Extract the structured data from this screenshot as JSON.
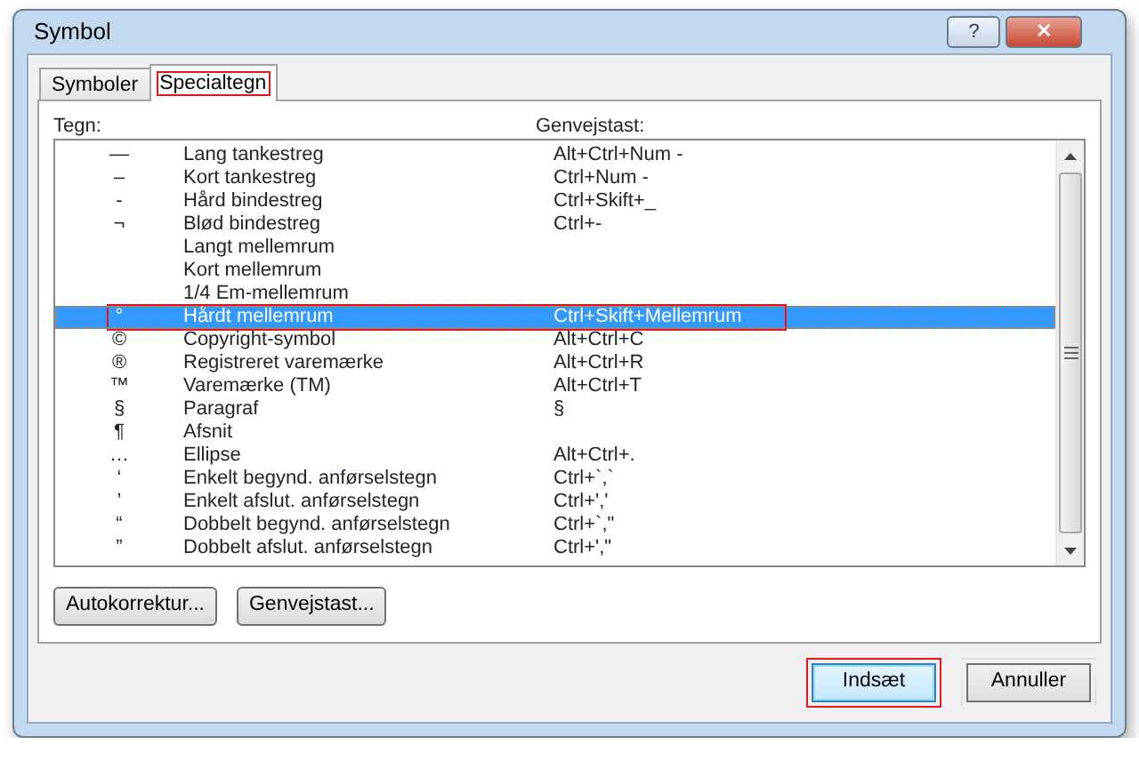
{
  "window": {
    "title": "Symbol",
    "help_button": "?",
    "close_button": "✕"
  },
  "tabs": [
    {
      "label": "Symboler",
      "selected": false,
      "annotated": false
    },
    {
      "label": "Specialtegn",
      "selected": true,
      "annotated": true
    }
  ],
  "columns": [
    "Tegn:",
    "Genvejstast:"
  ],
  "rows": [
    {
      "symbol": "—",
      "name": "Lang tankestreg",
      "shortcut": "Alt+Ctrl+Num -",
      "selected": false,
      "annotated": false
    },
    {
      "symbol": "–",
      "name": "Kort tankestreg",
      "shortcut": "Ctrl+Num -",
      "selected": false,
      "annotated": false
    },
    {
      "symbol": "-",
      "name": "Hård bindestreg",
      "shortcut": "Ctrl+Skift+_",
      "selected": false,
      "annotated": false
    },
    {
      "symbol": "¬",
      "name": "Blød bindestreg",
      "shortcut": "Ctrl+-",
      "selected": false,
      "annotated": false
    },
    {
      "name": "Langt mellemrum",
      "selected": false,
      "annotated": false
    },
    {
      "name": "Kort mellemrum",
      "selected": false,
      "annotated": false
    },
    {
      "name": "1/4 Em-mellemrum",
      "selected": false,
      "annotated": false
    },
    {
      "symbol": "°",
      "name": "Hårdt mellemrum",
      "shortcut": "Ctrl+Skift+Mellemrum",
      "selected": true,
      "annotated": true
    },
    {
      "symbol": "©",
      "name": "Copyright-symbol",
      "shortcut": "Alt+Ctrl+C",
      "selected": false,
      "annotated": false
    },
    {
      "symbol": "®",
      "name": "Registreret varemærke",
      "shortcut": "Alt+Ctrl+R",
      "selected": false,
      "annotated": false
    },
    {
      "symbol": "™",
      "name": "Varemærke (TM)",
      "shortcut": "Alt+Ctrl+T",
      "selected": false,
      "annotated": false
    },
    {
      "symbol": "§",
      "name": "Paragraf",
      "shortcut": "§",
      "selected": false,
      "annotated": false
    },
    {
      "symbol": "¶",
      "name": "Afsnit",
      "selected": false,
      "annotated": false
    },
    {
      "symbol": "…",
      "name": "Ellipse",
      "shortcut": "Alt+Ctrl+.",
      "selected": false,
      "annotated": false
    },
    {
      "symbol": "‘",
      "name": "Enkelt begynd. anførselstegn",
      "shortcut": "Ctrl+`,`",
      "selected": false,
      "annotated": false
    },
    {
      "symbol": "’",
      "name": "Enkelt afslut. anførselstegn",
      "shortcut": "Ctrl+','",
      "selected": false,
      "annotated": false
    },
    {
      "symbol": "“",
      "name": "Dobbelt begynd. anførselstegn",
      "shortcut": "Ctrl+`,\"",
      "selected": false,
      "annotated": false
    },
    {
      "symbol": "”",
      "name": "Dobbelt afslut. anførselstegn",
      "shortcut": "Ctrl+',\"",
      "selected": false,
      "annotated": false
    }
  ],
  "panel_buttons": [
    "Autokorrektur...",
    "Genvejstast..."
  ],
  "dialog_buttons": [
    {
      "label": "Indsæt",
      "default": true,
      "annotated": true
    },
    {
      "label": "Annuller",
      "default": false,
      "annotated": false
    }
  ]
}
